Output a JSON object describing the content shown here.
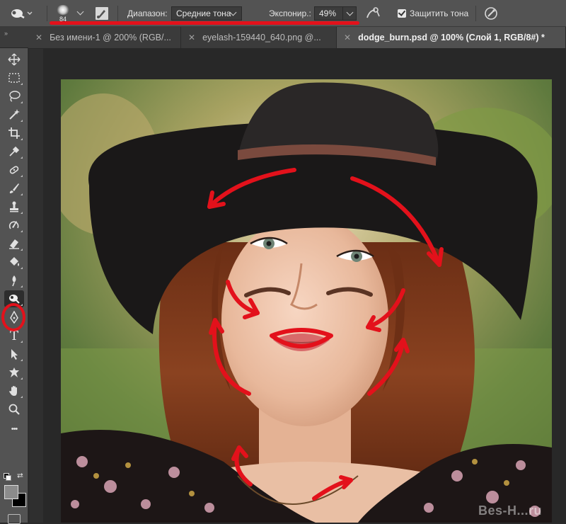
{
  "options_bar": {
    "brush_size": "84",
    "range_label": "Диапазон:",
    "range_value": "Средние тона",
    "exposure_label": "Экспонир.:",
    "exposure_value": "49%",
    "protect_tones_label": "Защитить тона",
    "protect_tones_checked": true
  },
  "tabs": [
    {
      "label": "Без имени-1 @ 200% (RGB/...",
      "active": false
    },
    {
      "label": "eyelash-159440_640.png @...",
      "active": false
    },
    {
      "label": "dodge_burn.psd @ 100% (Слой 1, RGB/8#) *",
      "active": true
    }
  ],
  "tools": [
    {
      "name": "move-tool-icon"
    },
    {
      "name": "marquee-tool-icon"
    },
    {
      "name": "lasso-tool-icon"
    },
    {
      "name": "magic-wand-tool-icon"
    },
    {
      "name": "crop-tool-icon"
    },
    {
      "name": "eyedropper-tool-icon"
    },
    {
      "name": "healing-brush-tool-icon"
    },
    {
      "name": "brush-tool-icon"
    },
    {
      "name": "clone-stamp-tool-icon"
    },
    {
      "name": "history-brush-tool-icon"
    },
    {
      "name": "eraser-tool-icon"
    },
    {
      "name": "paint-bucket-tool-icon"
    },
    {
      "name": "blur-tool-icon"
    },
    {
      "name": "dodge-tool-icon",
      "selected": true
    },
    {
      "name": "pen-tool-icon"
    },
    {
      "name": "type-tool-icon"
    },
    {
      "name": "path-selection-tool-icon"
    },
    {
      "name": "custom-shape-tool-icon"
    },
    {
      "name": "hand-tool-icon"
    },
    {
      "name": "zoom-tool-icon"
    },
    {
      "name": "more-tools-icon"
    }
  ],
  "type_tool_glyph": "T",
  "more_tools_glyph": "•••",
  "watermark": "Bes-H...ru",
  "colors": {
    "annotation_red": "#e3111b",
    "panel": "#535353",
    "tab_active": "#505050"
  }
}
